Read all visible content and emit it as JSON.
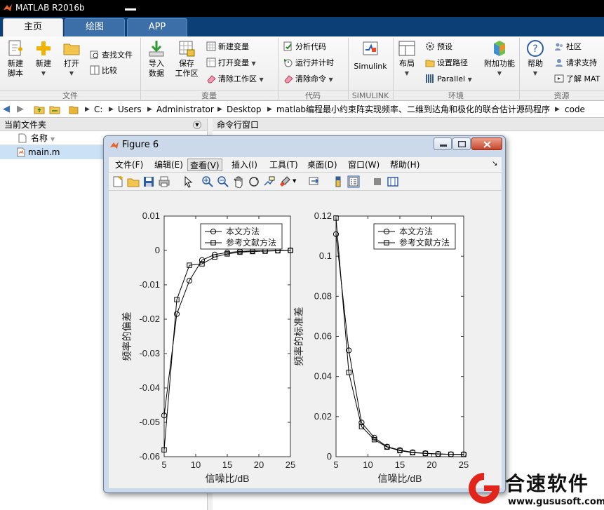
{
  "app": {
    "title": "MATLAB R2016b"
  },
  "tabs": [
    {
      "label": "主页",
      "active": true
    },
    {
      "label": "绘图",
      "active": false
    },
    {
      "label": "APP",
      "active": false
    }
  ],
  "ribbon": {
    "file": {
      "section": "文件",
      "new_script": [
        "新建",
        "脚本"
      ],
      "new": "新建",
      "open": "打开",
      "find_files": "查找文件",
      "compare": "比较"
    },
    "variable": {
      "section": "变量",
      "import_data": [
        "导入",
        "数据"
      ],
      "save_workspace": [
        "保存",
        "工作区"
      ],
      "new_variable": "新建变量",
      "open_variable": "打开变量",
      "clear_workspace": "清除工作区"
    },
    "code": {
      "section": "代码",
      "analyze_code": "分析代码",
      "run_and_time": "运行并计时",
      "clear_commands": "清除命令"
    },
    "simulink": {
      "section": "SIMULINK",
      "label": "Simulink"
    },
    "environment": {
      "section": "环境",
      "layout": "布局",
      "preferences": "预设",
      "set_path": "设置路径",
      "parallel": "Parallel",
      "add_ons": "附加功能"
    },
    "resources": {
      "section": "资源",
      "help": "帮助",
      "community": "社区",
      "request_support": "请求支持",
      "learn_matlab": "了解 MAT"
    }
  },
  "address": {
    "segments": [
      "C:",
      "Users",
      "Administrator",
      "Desktop",
      "matlab编程最小约束阵实现频率、二维到达角和极化的联合估计源码程序",
      "code"
    ]
  },
  "current_folder": {
    "header": "当前文件夹",
    "column_name": "名称",
    "files": [
      "main.m"
    ]
  },
  "command_window": {
    "header": "命令行窗口"
  },
  "figure": {
    "title": "Figure 6",
    "menu": [
      "文件(F)",
      "编辑(E)",
      "查看(V)",
      "插入(I)",
      "工具(T)",
      "桌面(D)",
      "窗口(W)",
      "帮助(H)"
    ],
    "active_menu": 2
  },
  "chart_data": [
    {
      "type": "line",
      "x": [
        5,
        7,
        9,
        11,
        13,
        15,
        17,
        19,
        21,
        23,
        25
      ],
      "xlim": [
        5,
        25
      ],
      "ylim": [
        -0.06,
        0.01
      ],
      "xticks": [
        "5",
        "10",
        "15",
        "20",
        "25"
      ],
      "yticks": [
        "0.01",
        "0",
        "-0.01",
        "-0.02",
        "-0.03",
        "-0.04",
        "-0.05",
        "-0.06"
      ],
      "xlabel": "信噪比/dB",
      "ylabel": "频率的偏差",
      "legend_position": "top-right",
      "grid": false,
      "series": [
        {
          "name": "本文方法",
          "marker": "circle",
          "values": [
            -0.048,
            -0.0185,
            -0.0088,
            -0.0028,
            -0.0012,
            -0.0006,
            -0.0003,
            -0.0001,
            -0.0001,
            0,
            0
          ]
        },
        {
          "name": "参考文献方法",
          "marker": "square",
          "values": [
            -0.058,
            -0.0143,
            -0.0043,
            -0.0039,
            -0.0019,
            -0.001,
            -0.0005,
            -0.0003,
            -0.0002,
            -0.0001,
            0
          ]
        }
      ]
    },
    {
      "type": "line",
      "x": [
        5,
        7,
        9,
        11,
        13,
        15,
        17,
        19,
        21,
        23,
        25
      ],
      "xlim": [
        5,
        25
      ],
      "ylim": [
        0,
        0.12
      ],
      "xticks": [
        "5",
        "10",
        "15",
        "20",
        "25"
      ],
      "yticks": [
        "0.12",
        "0.1",
        "0.08",
        "0.06",
        "0.04",
        "0.02",
        "0"
      ],
      "xlabel": "信噪比/dB",
      "ylabel": "频率的标准差",
      "legend_position": "top-right",
      "grid": false,
      "series": [
        {
          "name": "本文方法",
          "marker": "circle",
          "values": [
            0.111,
            0.053,
            0.017,
            0.0095,
            0.005,
            0.0033,
            0.0022,
            0.0017,
            0.0014,
            0.0012,
            0.0012
          ]
        },
        {
          "name": "参考文献方法",
          "marker": "square",
          "values": [
            0.119,
            0.042,
            0.015,
            0.0085,
            0.0048,
            0.003,
            0.002,
            0.0016,
            0.0013,
            0.0012,
            0.0011
          ]
        }
      ]
    }
  ],
  "watermark": {
    "text": "合速软件",
    "url": "www.gususoft.com"
  }
}
